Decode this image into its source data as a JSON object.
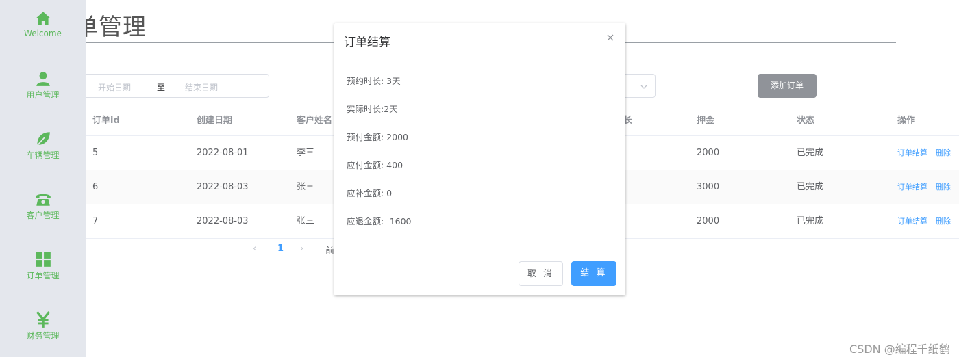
{
  "brand_color": "#5cb85c",
  "primary_color": "#409eff",
  "sidebar": {
    "items": [
      {
        "label": "Welcome",
        "icon": "home-icon"
      },
      {
        "label": "用户管理",
        "icon": "user-icon"
      },
      {
        "label": "车辆管理",
        "icon": "leaf-icon"
      },
      {
        "label": "客户管理",
        "icon": "phone-icon"
      },
      {
        "label": "订单管理",
        "icon": "grid-icon"
      },
      {
        "label": "财务管理",
        "icon": "yen-icon"
      }
    ]
  },
  "page": {
    "title_visible": "管理",
    "title_partial_char": "单"
  },
  "filters": {
    "start_placeholder": "开始日期",
    "range_separator": "至",
    "end_placeholder": "结束日期",
    "add_button": "添加订单"
  },
  "table": {
    "columns": [
      "订单id",
      "创建日期",
      "客户姓名",
      "长",
      "押金",
      "状态",
      "操作"
    ],
    "rows": [
      {
        "id": "5",
        "date": "2022-08-01",
        "name": "李三",
        "deposit": "2000",
        "status": "已完成"
      },
      {
        "id": "6",
        "date": "2022-08-03",
        "name": "张三",
        "deposit": "3000",
        "status": "已完成"
      },
      {
        "id": "7",
        "date": "2022-08-03",
        "name": "张三",
        "deposit": "2000",
        "status": "已完成"
      }
    ],
    "action_settle": "订单结算",
    "action_delete": "删除"
  },
  "pagination": {
    "prev": "‹",
    "current": "1",
    "next": "›",
    "goto_partial": "前"
  },
  "dialog": {
    "title": "订单结算",
    "lines": [
      "预约时长: 3天",
      "实际时长:2天",
      "预付金额: 2000",
      "应付金额: 400",
      "应补金额: 0",
      "应退金额: -1600"
    ],
    "cancel": "取 消",
    "confirm": "结 算"
  },
  "watermark": "CSDN @编程千纸鹤"
}
